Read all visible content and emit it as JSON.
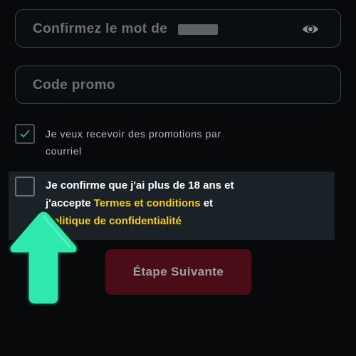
{
  "fields": {
    "confirm_password": {
      "placeholder": "Confirmez le mot de"
    },
    "promo_code": {
      "placeholder": "Code promo"
    }
  },
  "checkboxes": {
    "promotions": {
      "checked": true,
      "label": "Je veux recevoir des promotions par courriel"
    },
    "terms": {
      "checked": false,
      "label_prefix": "Je confirme que j'ai plus de 18 ans et j'accepte ",
      "terms_link": "Termes et conditions",
      "label_middle": " et ",
      "privacy_link": "Politique de confidentialité"
    }
  },
  "buttons": {
    "next": "Étape Suivante"
  },
  "icons": {
    "eye": "eye-icon",
    "check": "checkmark-icon",
    "arrow": "up-arrow-icon"
  },
  "colors": {
    "accent_link": "#f3cb1e",
    "button_bg": "#4a0d18",
    "arrow": "#2ee8ad",
    "check": "#3cbf7a"
  }
}
